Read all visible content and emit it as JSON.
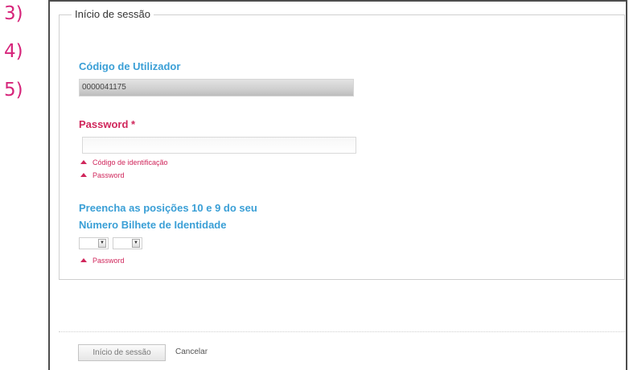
{
  "step_markers": [
    "3)",
    "4)",
    "5)"
  ],
  "login": {
    "legend": "Início de sessão",
    "user_code_label": "Código de Utilizador",
    "user_code_value": "0000041175",
    "password_label": "Password *",
    "password_value": "",
    "errors_password": [
      "Código de identificação",
      "Password"
    ],
    "id_positions_line1": "Preencha as posições 10 e 9 do seu",
    "id_positions_line2": "Número Bilhete de Identidade",
    "id_error": "Password",
    "select1_value": "",
    "select2_value": ""
  },
  "footer": {
    "login_button": "Início de sessão",
    "cancel_link": "Cancelar"
  },
  "colors": {
    "step_marker": "#d6247a",
    "blue_label": "#3a9fd6",
    "red_label": "#d0265b"
  },
  "icons": {
    "error": "triangle-up",
    "dropdown": "chevron-down"
  }
}
